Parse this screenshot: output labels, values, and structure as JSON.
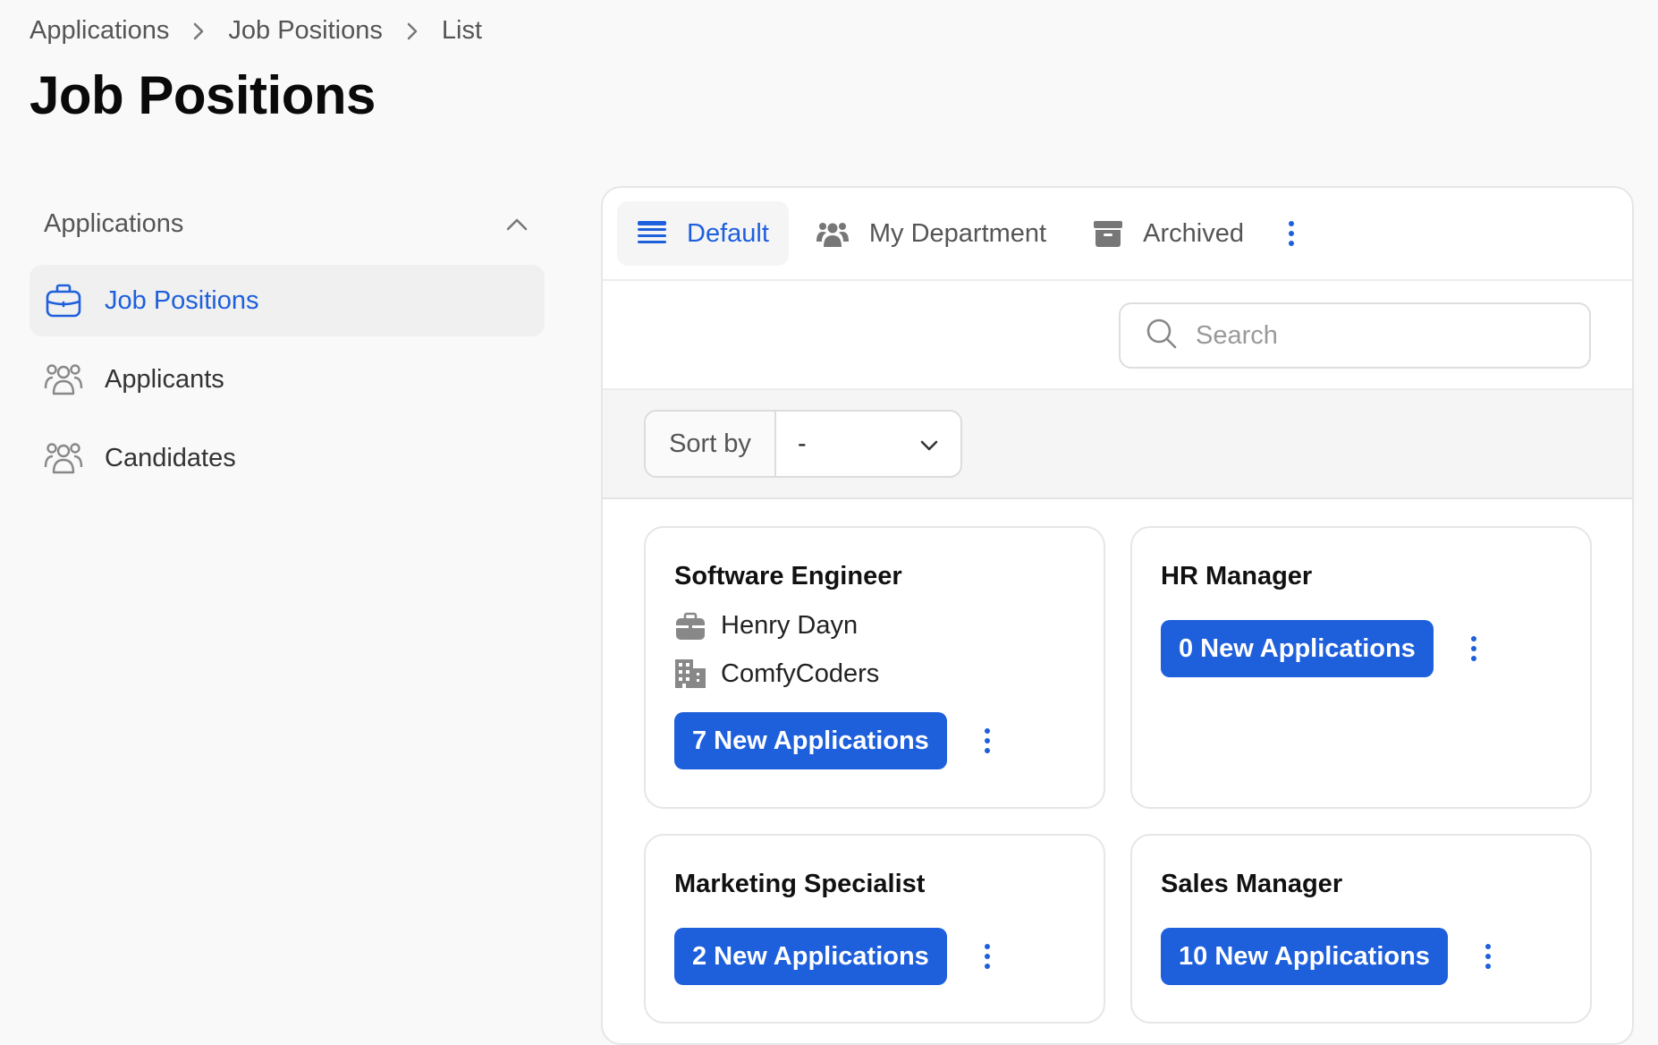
{
  "breadcrumb": {
    "items": [
      "Applications",
      "Job Positions",
      "List"
    ]
  },
  "page_title": "Job Positions",
  "sidebar": {
    "group_label": "Applications",
    "items": [
      {
        "label": "Job Positions",
        "icon": "briefcase-icon",
        "active": true
      },
      {
        "label": "Applicants",
        "icon": "users-icon",
        "active": false
      },
      {
        "label": "Candidates",
        "icon": "users-icon",
        "active": false
      }
    ]
  },
  "tabs": [
    {
      "label": "Default",
      "icon": "list-icon",
      "active": true
    },
    {
      "label": "My Department",
      "icon": "users-icon",
      "active": false
    },
    {
      "label": "Archived",
      "icon": "archive-icon",
      "active": false
    }
  ],
  "search": {
    "placeholder": "Search",
    "value": ""
  },
  "sort": {
    "label": "Sort by",
    "value": "-"
  },
  "cards": [
    {
      "title": "Software Engineer",
      "manager": "Henry Dayn",
      "company": "ComfyCoders",
      "button": "7 New Applications"
    },
    {
      "title": "HR Manager",
      "button": "0 New Applications"
    },
    {
      "title": "Marketing Specialist",
      "button": "2 New Applications"
    },
    {
      "title": "Sales Manager",
      "button": "10 New Applications"
    }
  ],
  "colors": {
    "accent": "#1e5fdc",
    "text_muted": "#555555",
    "background": "#f9f9f9"
  }
}
